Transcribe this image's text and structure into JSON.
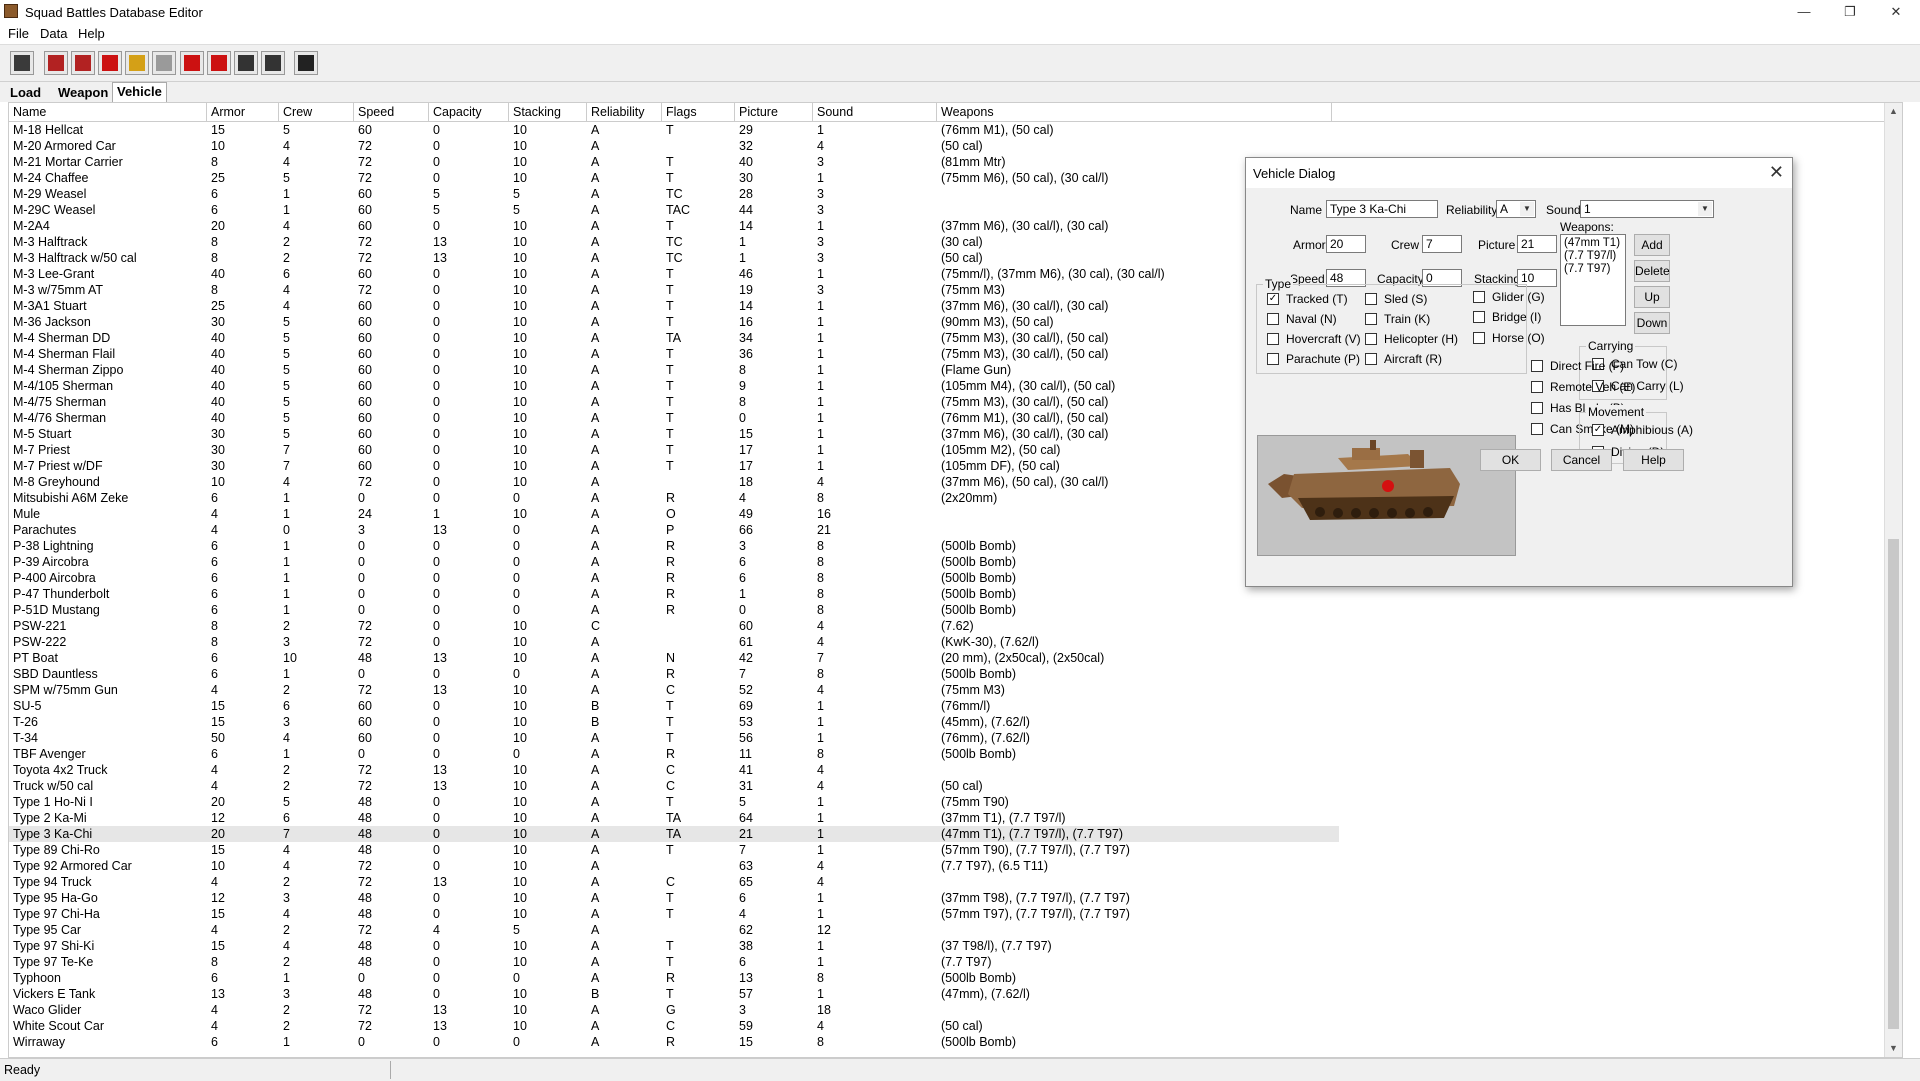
{
  "window": {
    "title": "Squad Battles Database Editor",
    "minimize": "—",
    "restore": "❐",
    "close": "✕"
  },
  "menu": [
    "File",
    "Data",
    "Help"
  ],
  "toolbar": {
    "buttons": [
      {
        "name": "save-db-icon",
        "color": "#3a3a3a"
      },
      {
        "name": "new-record-icon",
        "color": "#b22222"
      },
      {
        "name": "copy-record-icon",
        "color": "#b22222"
      },
      {
        "name": "delete-record-icon",
        "color": "#cc1111"
      },
      {
        "name": "edit-record-icon",
        "color": "#d4a017"
      },
      {
        "name": "blank-icon",
        "color": "#9a9a9a"
      },
      {
        "name": "move-up-icon",
        "color": "#cc1111"
      },
      {
        "name": "move-down-icon",
        "color": "#cc1111"
      },
      {
        "name": "find-icon",
        "color": "#333333"
      },
      {
        "name": "find-next-icon",
        "color": "#333333"
      },
      {
        "name": "help-icon",
        "color": "#222222"
      }
    ]
  },
  "tabs": [
    "Load",
    "Weapon",
    "Vehicle"
  ],
  "active_tab": "Vehicle",
  "table": {
    "columns": [
      "Name",
      "Armor",
      "Crew",
      "Speed",
      "Capacity",
      "Stacking",
      "Reliability",
      "Flags",
      "Picture",
      "Sound",
      "Weapons"
    ],
    "selected_row": "Type 3 Ka-Chi",
    "rows": [
      [
        "M-18 Hellcat",
        "15",
        "5",
        "60",
        "0",
        "10",
        "A",
        "T",
        "29",
        "1",
        "(76mm M1), (50 cal)"
      ],
      [
        "M-20 Armored Car",
        "10",
        "4",
        "72",
        "0",
        "10",
        "A",
        "",
        "32",
        "4",
        "(50 cal)"
      ],
      [
        "M-21 Mortar Carrier",
        "8",
        "4",
        "72",
        "0",
        "10",
        "A",
        "T",
        "40",
        "3",
        "(81mm Mtr)"
      ],
      [
        "M-24 Chaffee",
        "25",
        "5",
        "72",
        "0",
        "10",
        "A",
        "T",
        "30",
        "1",
        "(75mm M6), (50 cal), (30 cal/l)"
      ],
      [
        "M-29 Weasel",
        "6",
        "1",
        "60",
        "5",
        "5",
        "A",
        "TC",
        "28",
        "3",
        ""
      ],
      [
        "M-29C Weasel",
        "6",
        "1",
        "60",
        "5",
        "5",
        "A",
        "TAC",
        "44",
        "3",
        ""
      ],
      [
        "M-2A4",
        "20",
        "4",
        "60",
        "0",
        "10",
        "A",
        "T",
        "14",
        "1",
        "(37mm M6), (30 cal/l), (30 cal)"
      ],
      [
        "M-3 Halftrack",
        "8",
        "2",
        "72",
        "13",
        "10",
        "A",
        "TC",
        "1",
        "3",
        "(30 cal)"
      ],
      [
        "M-3 Halftrack w/50 cal",
        "8",
        "2",
        "72",
        "13",
        "10",
        "A",
        "TC",
        "1",
        "3",
        "(50 cal)"
      ],
      [
        "M-3 Lee-Grant",
        "40",
        "6",
        "60",
        "0",
        "10",
        "A",
        "T",
        "46",
        "1",
        "(75mm/l), (37mm M6), (30 cal), (30 cal/l)"
      ],
      [
        "M-3 w/75mm AT",
        "8",
        "4",
        "72",
        "0",
        "10",
        "A",
        "T",
        "19",
        "3",
        "(75mm M3)"
      ],
      [
        "M-3A1 Stuart",
        "25",
        "4",
        "60",
        "0",
        "10",
        "A",
        "T",
        "14",
        "1",
        "(37mm M6), (30 cal/l), (30 cal)"
      ],
      [
        "M-36 Jackson",
        "30",
        "5",
        "60",
        "0",
        "10",
        "A",
        "T",
        "16",
        "1",
        "(90mm M3), (50 cal)"
      ],
      [
        "M-4 Sherman DD",
        "40",
        "5",
        "60",
        "0",
        "10",
        "A",
        "TA",
        "34",
        "1",
        "(75mm M3), (30 cal/l), (50 cal)"
      ],
      [
        "M-4 Sherman Flail",
        "40",
        "5",
        "60",
        "0",
        "10",
        "A",
        "T",
        "36",
        "1",
        "(75mm M3), (30 cal/l), (50 cal)"
      ],
      [
        "M-4 Sherman Zippo",
        "40",
        "5",
        "60",
        "0",
        "10",
        "A",
        "T",
        "8",
        "1",
        "(Flame Gun)"
      ],
      [
        "M-4/105 Sherman",
        "40",
        "5",
        "60",
        "0",
        "10",
        "A",
        "T",
        "9",
        "1",
        "(105mm M4), (30 cal/l), (50 cal)"
      ],
      [
        "M-4/75 Sherman",
        "40",
        "5",
        "60",
        "0",
        "10",
        "A",
        "T",
        "8",
        "1",
        "(75mm M3), (30 cal/l), (50 cal)"
      ],
      [
        "M-4/76 Sherman",
        "40",
        "5",
        "60",
        "0",
        "10",
        "A",
        "T",
        "0",
        "1",
        "(76mm M1), (30 cal/l), (50 cal)"
      ],
      [
        "M-5 Stuart",
        "30",
        "5",
        "60",
        "0",
        "10",
        "A",
        "T",
        "15",
        "1",
        "(37mm M6), (30 cal/l), (30 cal)"
      ],
      [
        "M-7 Priest",
        "30",
        "7",
        "60",
        "0",
        "10",
        "A",
        "T",
        "17",
        "1",
        "(105mm M2), (50 cal)"
      ],
      [
        "M-7 Priest w/DF",
        "30",
        "7",
        "60",
        "0",
        "10",
        "A",
        "T",
        "17",
        "1",
        "(105mm DF), (50 cal)"
      ],
      [
        "M-8 Greyhound",
        "10",
        "4",
        "72",
        "0",
        "10",
        "A",
        "",
        "18",
        "4",
        "(37mm M6), (50 cal), (30 cal/l)"
      ],
      [
        "Mitsubishi A6M Zeke",
        "6",
        "1",
        "0",
        "0",
        "0",
        "A",
        "R",
        "4",
        "8",
        "(2x20mm)"
      ],
      [
        "Mule",
        "4",
        "1",
        "24",
        "1",
        "10",
        "A",
        "O",
        "49",
        "16",
        ""
      ],
      [
        "Parachutes",
        "4",
        "0",
        "3",
        "13",
        "0",
        "A",
        "P",
        "66",
        "21",
        ""
      ],
      [
        "P-38 Lightning",
        "6",
        "1",
        "0",
        "0",
        "0",
        "A",
        "R",
        "3",
        "8",
        "(500lb Bomb)"
      ],
      [
        "P-39 Aircobra",
        "6",
        "1",
        "0",
        "0",
        "0",
        "A",
        "R",
        "6",
        "8",
        "(500lb Bomb)"
      ],
      [
        "P-400 Aircobra",
        "6",
        "1",
        "0",
        "0",
        "0",
        "A",
        "R",
        "6",
        "8",
        "(500lb Bomb)"
      ],
      [
        "P-47 Thunderbolt",
        "6",
        "1",
        "0",
        "0",
        "0",
        "A",
        "R",
        "1",
        "8",
        "(500lb Bomb)"
      ],
      [
        "P-51D Mustang",
        "6",
        "1",
        "0",
        "0",
        "0",
        "A",
        "R",
        "0",
        "8",
        "(500lb Bomb)"
      ],
      [
        "PSW-221",
        "8",
        "2",
        "72",
        "0",
        "10",
        "C",
        "",
        "60",
        "4",
        "(7.62)"
      ],
      [
        "PSW-222",
        "8",
        "3",
        "72",
        "0",
        "10",
        "A",
        "",
        "61",
        "4",
        "(KwK-30), (7.62/l)"
      ],
      [
        "PT Boat",
        "6",
        "10",
        "48",
        "13",
        "10",
        "A",
        "N",
        "42",
        "7",
        "(20 mm), (2x50cal), (2x50cal)"
      ],
      [
        "SBD Dauntless",
        "6",
        "1",
        "0",
        "0",
        "0",
        "A",
        "R",
        "7",
        "8",
        "(500lb Bomb)"
      ],
      [
        "SPM w/75mm Gun",
        "4",
        "2",
        "72",
        "13",
        "10",
        "A",
        "C",
        "52",
        "4",
        "(75mm M3)"
      ],
      [
        "SU-5",
        "15",
        "6",
        "60",
        "0",
        "10",
        "B",
        "T",
        "69",
        "1",
        "(76mm/l)"
      ],
      [
        "T-26",
        "15",
        "3",
        "60",
        "0",
        "10",
        "B",
        "T",
        "53",
        "1",
        "(45mm), (7.62/l)"
      ],
      [
        "T-34",
        "50",
        "4",
        "60",
        "0",
        "10",
        "A",
        "T",
        "56",
        "1",
        "(76mm), (7.62/l)"
      ],
      [
        "TBF Avenger",
        "6",
        "1",
        "0",
        "0",
        "0",
        "A",
        "R",
        "11",
        "8",
        "(500lb Bomb)"
      ],
      [
        "Toyota 4x2 Truck",
        "4",
        "2",
        "72",
        "13",
        "10",
        "A",
        "C",
        "41",
        "4",
        ""
      ],
      [
        "Truck w/50 cal",
        "4",
        "2",
        "72",
        "13",
        "10",
        "A",
        "C",
        "31",
        "4",
        "(50 cal)"
      ],
      [
        "Type 1 Ho-Ni I",
        "20",
        "5",
        "48",
        "0",
        "10",
        "A",
        "T",
        "5",
        "1",
        "(75mm T90)"
      ],
      [
        "Type 2 Ka-Mi",
        "12",
        "6",
        "48",
        "0",
        "10",
        "A",
        "TA",
        "64",
        "1",
        "(37mm T1), (7.7 T97/l)"
      ],
      [
        "Type 3 Ka-Chi",
        "20",
        "7",
        "48",
        "0",
        "10",
        "A",
        "TA",
        "21",
        "1",
        "(47mm T1), (7.7 T97/l), (7.7 T97)"
      ],
      [
        "Type 89 Chi-Ro",
        "15",
        "4",
        "48",
        "0",
        "10",
        "A",
        "T",
        "7",
        "1",
        "(57mm T90), (7.7 T97/l), (7.7 T97)"
      ],
      [
        "Type 92 Armored Car",
        "10",
        "4",
        "72",
        "0",
        "10",
        "A",
        "",
        "63",
        "4",
        "(7.7 T97), (6.5 T11)"
      ],
      [
        "Type 94 Truck",
        "4",
        "2",
        "72",
        "13",
        "10",
        "A",
        "C",
        "65",
        "4",
        ""
      ],
      [
        "Type 95 Ha-Go",
        "12",
        "3",
        "48",
        "0",
        "10",
        "A",
        "T",
        "6",
        "1",
        "(37mm T98), (7.7 T97/l), (7.7 T97)"
      ],
      [
        "Type 97 Chi-Ha",
        "15",
        "4",
        "48",
        "0",
        "10",
        "A",
        "T",
        "4",
        "1",
        "(57mm T97), (7.7 T97/l), (7.7 T97)"
      ],
      [
        "Type 95 Car",
        "4",
        "2",
        "72",
        "4",
        "5",
        "A",
        "",
        "62",
        "12",
        ""
      ],
      [
        "Type 97 Shi-Ki",
        "15",
        "4",
        "48",
        "0",
        "10",
        "A",
        "T",
        "38",
        "1",
        "(37 T98/l), (7.7 T97)"
      ],
      [
        "Type 97 Te-Ke",
        "8",
        "2",
        "48",
        "0",
        "10",
        "A",
        "T",
        "6",
        "1",
        "(7.7 T97)"
      ],
      [
        "Typhoon",
        "6",
        "1",
        "0",
        "0",
        "0",
        "A",
        "R",
        "13",
        "8",
        "(500lb Bomb)"
      ],
      [
        "Vickers E Tank",
        "13",
        "3",
        "48",
        "0",
        "10",
        "B",
        "T",
        "57",
        "1",
        "(47mm), (7.62/l)"
      ],
      [
        "Waco Glider",
        "4",
        "2",
        "72",
        "13",
        "10",
        "A",
        "G",
        "3",
        "18",
        ""
      ],
      [
        "White Scout Car",
        "4",
        "2",
        "72",
        "13",
        "10",
        "A",
        "C",
        "59",
        "4",
        "(50 cal)"
      ],
      [
        "Wirraway",
        "6",
        "1",
        "0",
        "0",
        "0",
        "A",
        "R",
        "15",
        "8",
        "(500lb Bomb)"
      ]
    ]
  },
  "status": "Ready",
  "dialog": {
    "title": "Vehicle Dialog",
    "close": "✕",
    "name_label": "Name",
    "name_value": "Type 3 Ka-Chi",
    "reliability_label": "Reliability",
    "reliability_value": "A",
    "sound_label": "Sound",
    "sound_value": "1",
    "armor_label": "Armor",
    "armor_value": "20",
    "crew_label": "Crew",
    "crew_value": "7",
    "picture_label": "Picture",
    "picture_value": "21",
    "speed_label": "Speed",
    "speed_value": "48",
    "capacity_label": "Capacity",
    "capacity_value": "0",
    "stacking_label": "Stacking",
    "stacking_value": "10",
    "weapons_label": "Weapons:",
    "weapons": [
      "(47mm T1)",
      "(7.7 T97/l)",
      "(7.7 T97)"
    ],
    "weapon_buttons": [
      "Add",
      "Delete",
      "Up",
      "Down"
    ],
    "type_group": "Type",
    "type_checks": [
      {
        "label": "Tracked (T)",
        "checked": true
      },
      {
        "label": "Sled (S)",
        "checked": false
      },
      {
        "label": "Glider (G)",
        "checked": false
      },
      {
        "label": "Naval (N)",
        "checked": false
      },
      {
        "label": "Train (K)",
        "checked": false
      },
      {
        "label": "Bridge (I)",
        "checked": false
      },
      {
        "label": "Hovercraft (V)",
        "checked": false
      },
      {
        "label": "Helicopter (H)",
        "checked": false
      },
      {
        "label": "Horse (O)",
        "checked": false
      },
      {
        "label": "Parachute (P)",
        "checked": false
      },
      {
        "label": "Aircraft (R)",
        "checked": false
      }
    ],
    "carrying_group": "Carrying",
    "carrying_checks": [
      {
        "label": "Can Tow (C)",
        "checked": false
      },
      {
        "label": "Can Carry (L)",
        "checked": false
      }
    ],
    "feature_checks": [
      {
        "label": "Direct Fire (F)",
        "checked": false
      },
      {
        "label": "Remote Veh (E)",
        "checked": false
      },
      {
        "label": "Has Blade (B)",
        "checked": false
      },
      {
        "label": "Can Smoke (M)",
        "checked": false
      }
    ],
    "movement_group": "Movement",
    "movement_checks": [
      {
        "label": "Amphibious (A)",
        "checked": true
      },
      {
        "label": "Diving (D)",
        "checked": false
      }
    ],
    "check_mark": "✓",
    "ok_label": "OK",
    "cancel_label": "Cancel",
    "help_label": "Help"
  }
}
